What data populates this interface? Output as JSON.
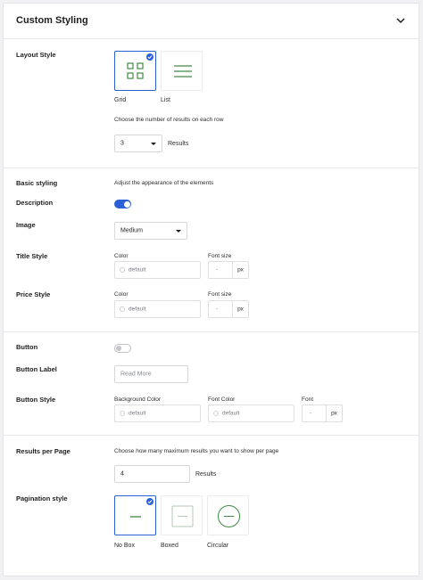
{
  "header": {
    "title": "Custom Styling",
    "collapse_icon": "chevron-down-icon"
  },
  "layout_style": {
    "label": "Layout Style",
    "options": [
      {
        "label": "Grid",
        "icon": "grid-icon",
        "selected": true
      },
      {
        "label": "List",
        "icon": "list-icon",
        "selected": false
      }
    ],
    "columns_hint": "Choose the number of results on each row",
    "columns_value": "3",
    "columns_suffix": "Results"
  },
  "basic_styling": {
    "label": "Basic styling",
    "hint": "Adjust the appearance of the elements"
  },
  "description": {
    "label": "Description",
    "enabled": true
  },
  "image": {
    "label": "Image",
    "value": "Medium"
  },
  "title_style": {
    "label": "Title Style",
    "color_label": "Color",
    "color_value": "default",
    "font_size_label": "Font size",
    "font_size_value": "-",
    "unit": "px"
  },
  "price_style": {
    "label": "Price Style",
    "color_label": "Color",
    "color_value": "default",
    "font_size_label": "Font size",
    "font_size_value": "-",
    "unit": "px"
  },
  "button": {
    "label": "Button",
    "enabled": false
  },
  "button_label": {
    "label": "Button Label",
    "placeholder": "Read More"
  },
  "button_style": {
    "label": "Button Style",
    "bg_label": "Background Color",
    "bg_value": "default",
    "font_color_label": "Font Color",
    "font_color_value": "default",
    "font_label": "Font",
    "font_value": "-",
    "unit": "px"
  },
  "results_per_page": {
    "label": "Results per Page",
    "hint": "Choose how many maximum results you want to show per page",
    "value": "4",
    "suffix": "Results"
  },
  "pagination": {
    "label": "Pagination style",
    "options": [
      {
        "label": "No Box",
        "icon": "no-box-icon",
        "selected": true
      },
      {
        "label": "Boxed",
        "icon": "boxed-icon",
        "selected": false
      },
      {
        "label": "Circular",
        "icon": "circular-icon",
        "selected": false
      }
    ]
  },
  "colors": {
    "accent": "#2d5fd8",
    "icon_green": "#3f8a43"
  }
}
